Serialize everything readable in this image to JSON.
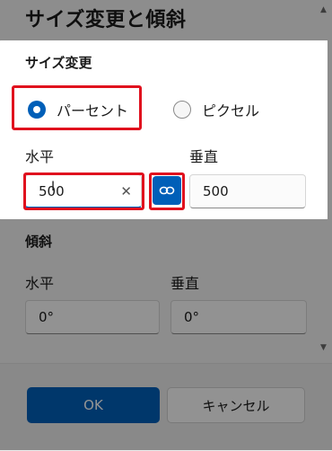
{
  "dialog": {
    "title": "サイズ変更と傾斜"
  },
  "resize": {
    "heading": "サイズ変更",
    "mode_options": [
      {
        "label": "パーセント",
        "selected": true
      },
      {
        "label": "ピクセル",
        "selected": false
      }
    ],
    "horizontal_label": "水平",
    "vertical_label": "垂直",
    "horizontal_value": "500",
    "vertical_value": "500",
    "aspect_locked": true
  },
  "skew": {
    "heading": "傾斜",
    "horizontal_label": "水平",
    "vertical_label": "垂直",
    "horizontal_value": "0°",
    "vertical_value": "0°"
  },
  "buttons": {
    "ok": "OK",
    "cancel": "キャンセル"
  },
  "colors": {
    "accent": "#005fb8",
    "highlight": "#e0101e"
  }
}
